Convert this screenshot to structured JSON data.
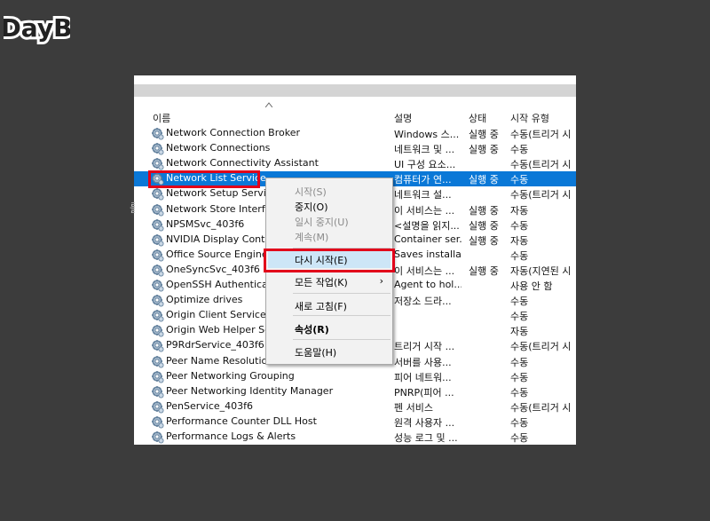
{
  "watermark": {
    "text": "DayB"
  },
  "colors": {
    "selection": "#0a78d7",
    "highlight_box": "#e2001a",
    "menu_hover": "#cde6f7"
  },
  "side_label": "를",
  "columns": {
    "name": "이름",
    "description": "설명",
    "status": "상태",
    "startup_type": "시작 유형"
  },
  "services": [
    {
      "name": "Network Connection Broker",
      "description": "Windows 스...",
      "status": "실행 중",
      "startup_type": "수동(트리거 시"
    },
    {
      "name": "Network Connections",
      "description": "네트워크 및 ...",
      "status": "실행 중",
      "startup_type": "수동"
    },
    {
      "name": "Network Connectivity Assistant",
      "description": "UI 구성 요소...",
      "status": "",
      "startup_type": "수동(트리거 시"
    },
    {
      "name": "Network List Service",
      "description": "컴퓨터가 연...",
      "status": "실행 중",
      "startup_type": "수동"
    },
    {
      "name": "Network Setup Service",
      "description": "네트워크 설...",
      "status": "",
      "startup_type": "수동(트리거 시"
    },
    {
      "name": "Network Store Interface",
      "description": "이 서비스는 ...",
      "status": "실행 중",
      "startup_type": "자동"
    },
    {
      "name": "NPSMSvc_403f6",
      "description": "<설명을 읽지...",
      "status": "실행 중",
      "startup_type": "수동"
    },
    {
      "name": "NVIDIA Display Contair",
      "description": "Container ser...",
      "status": "실행 중",
      "startup_type": "자동"
    },
    {
      "name": "Office Source Engine",
      "description": "Saves installa...",
      "status": "",
      "startup_type": "수동"
    },
    {
      "name": "OneSyncSvc_403f6",
      "description": "이 서비스는 ...",
      "status": "실행 중",
      "startup_type": "자동(지연된 시"
    },
    {
      "name": "OpenSSH Authenticatio",
      "description": "Agent to hol...",
      "status": "",
      "startup_type": "사용 안 함"
    },
    {
      "name": "Optimize drives",
      "description": "저장소 드라...",
      "status": "",
      "startup_type": "수동"
    },
    {
      "name": "Origin Client Service",
      "description": "",
      "status": "",
      "startup_type": "수동"
    },
    {
      "name": "Origin Web Helper Serv",
      "description": "",
      "status": "",
      "startup_type": "자동"
    },
    {
      "name": "P9RdrService_403f6",
      "description": "트리거 시작 ...",
      "status": "",
      "startup_type": "수동(트리거 시"
    },
    {
      "name": "Peer Name Resolution I",
      "description": "서버를 사용...",
      "status": "",
      "startup_type": "수동"
    },
    {
      "name": "Peer Networking Grouping",
      "description": "피어 네트워...",
      "status": "",
      "startup_type": "수동"
    },
    {
      "name": "Peer Networking Identity Manager",
      "description": "PNRP(피어 ...",
      "status": "",
      "startup_type": "수동"
    },
    {
      "name": "PenService_403f6",
      "description": "펜 서비스",
      "status": "",
      "startup_type": "수동(트리거 시"
    },
    {
      "name": "Performance Counter DLL Host",
      "description": "원격 사용자 ...",
      "status": "",
      "startup_type": "수동"
    },
    {
      "name": "Performance Logs & Alerts",
      "description": "성능 로그 및 ...",
      "status": "",
      "startup_type": "수동"
    }
  ],
  "selected_index": 3,
  "context_menu": [
    {
      "label": "시작(S)",
      "disabled": true
    },
    {
      "label": "중지(O)",
      "disabled": false
    },
    {
      "label": "일시 중지(U)",
      "disabled": true
    },
    {
      "label": "계속(M)",
      "disabled": true
    },
    {
      "label": "다시 시작(E)",
      "disabled": false,
      "highlighted": true
    },
    {
      "label": "모든 작업(K)",
      "disabled": false,
      "submenu": "›"
    },
    {
      "label": "새로 고침(F)",
      "disabled": false
    },
    {
      "label": "속성(R)",
      "disabled": false,
      "bold": true
    },
    {
      "label": "도움말(H)",
      "disabled": false
    }
  ]
}
